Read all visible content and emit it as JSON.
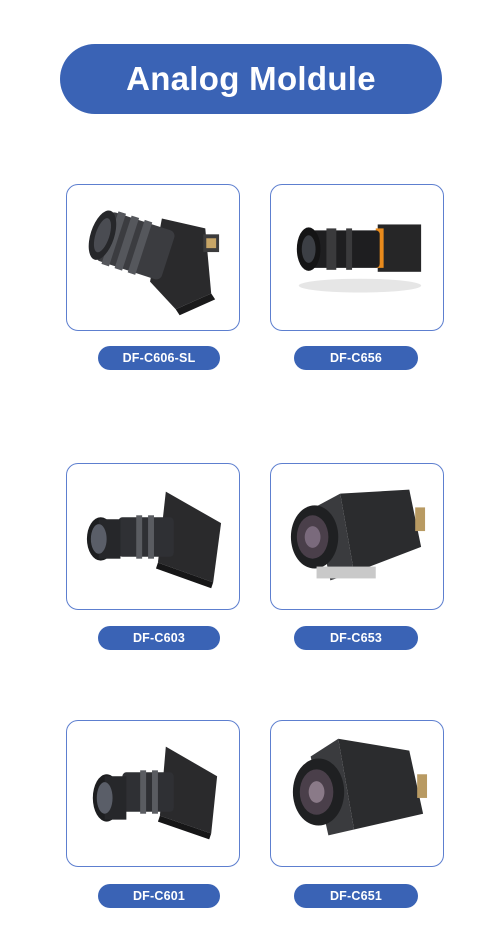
{
  "header": {
    "title": "Analog Moldule"
  },
  "products": [
    {
      "model": "DF-C606-SL",
      "image_icon": "long-lens-camera-module-icon"
    },
    {
      "model": "DF-C656",
      "image_icon": "zoom-lens-camera-module-icon"
    },
    {
      "model": "DF-C603",
      "image_icon": "board-camera-module-icon"
    },
    {
      "model": "DF-C653",
      "image_icon": "cube-camera-module-icon"
    },
    {
      "model": "DF-C601",
      "image_icon": "board-camera-module-icon"
    },
    {
      "model": "DF-C651",
      "image_icon": "cube-camera-module-icon"
    }
  ],
  "colors": {
    "accent": "#3a63b5",
    "card_border": "#5d7fcf"
  }
}
